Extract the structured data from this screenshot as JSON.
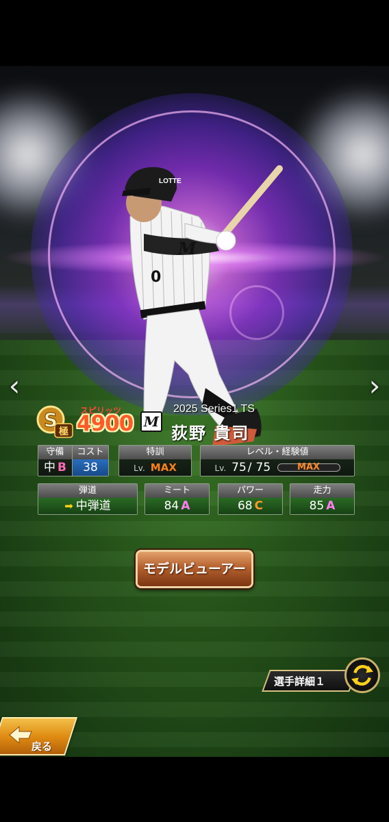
{
  "player_card": {
    "rank_letter": "S",
    "rank_sub": "極",
    "spirits_label": "スピリッツ",
    "spirits_value": "4900",
    "team_logo": "M",
    "series": "2025 Series1 TS",
    "name": "荻野 貴司"
  },
  "stats": {
    "defense": {
      "label": "守備",
      "position": "中",
      "grade": "B"
    },
    "cost": {
      "label": "コスト",
      "value": "38"
    },
    "training": {
      "label": "特訓",
      "lv": "Lv.",
      "value": "MAX"
    },
    "level": {
      "label": "レベル・経験値",
      "lv": "Lv.",
      "value": "75",
      "slash": "/",
      "max": "75",
      "exp": "MAX"
    },
    "trajectory": {
      "label": "弾道",
      "value": "中弾道"
    },
    "meet": {
      "label": "ミート",
      "value": "84",
      "grade": "A"
    },
    "power": {
      "label": "パワー",
      "value": "68",
      "grade": "C"
    },
    "speed": {
      "label": "走力",
      "value": "85",
      "grade": "A"
    }
  },
  "buttons": {
    "model_viewer": "モデルビューアー",
    "player_detail": "選手詳細１",
    "back": "戻る"
  },
  "nav": {
    "prev": "‹",
    "next": "›"
  },
  "uniform": {
    "helmet_text": "LOTTE",
    "chest_logo": "M",
    "number": "0"
  },
  "colors": {
    "spirits": "#ff5a28",
    "grade_a": "#ff7ff0",
    "grade_b": "#ff6ab5",
    "grade_c": "#ff9a2a",
    "max": "#ff7f1a",
    "button_brown": "#b5612e",
    "back_orange": "#e08c12"
  },
  "icons": [
    "chevron-left-icon",
    "chevron-right-icon",
    "swap-icon",
    "trajectory-arrow-icon",
    "back-arrow-icon",
    "rank-s-badge"
  ]
}
